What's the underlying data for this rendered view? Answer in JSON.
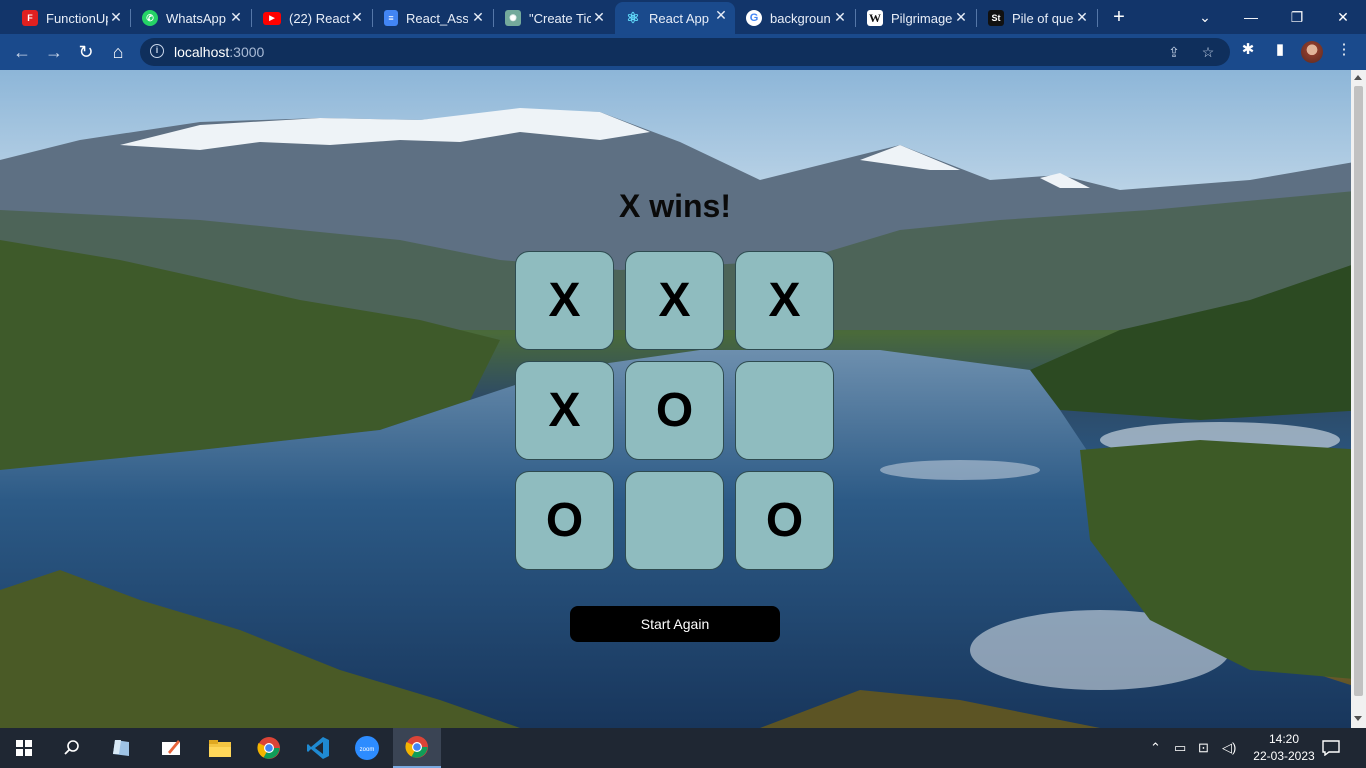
{
  "browser": {
    "tabs": [
      {
        "label": "FunctionUp",
        "icon": "functionup-icon",
        "color": "#e02020",
        "glyph": "F"
      },
      {
        "label": "WhatsApp",
        "icon": "whatsapp-icon",
        "color": "#25d366",
        "glyph": "✆"
      },
      {
        "label": "(22) React",
        "icon": "youtube-icon",
        "color": "#ff0000",
        "glyph": "▶"
      },
      {
        "label": "React_Assi",
        "icon": "google-docs-icon",
        "color": "#4285f4",
        "glyph": "≡"
      },
      {
        "label": "\"Create Tic",
        "icon": "chatgpt-icon",
        "color": "#74aa9c",
        "glyph": "✺"
      },
      {
        "label": "React App",
        "icon": "react-icon",
        "color": "#1a4a8c",
        "glyph": "⚛"
      },
      {
        "label": "backgroun",
        "icon": "google-icon",
        "color": "#ffffff",
        "glyph": "G"
      },
      {
        "label": "Pilgrimage",
        "icon": "wikipedia-icon",
        "color": "#ffffff",
        "glyph": "W"
      },
      {
        "label": "Pile of que",
        "icon": "stackoverflow-icon",
        "color": "#111111",
        "glyph": "St"
      }
    ],
    "active_tab": 5,
    "url_host": "localhost",
    "url_port": ":3000"
  },
  "game": {
    "status": "X wins!",
    "board": [
      "X",
      "X",
      "X",
      "X",
      "O",
      "",
      "O",
      "",
      "O"
    ],
    "restart_label": "Start Again"
  },
  "taskbar": {
    "time": "14:20",
    "date": "22-03-2023"
  },
  "colors": {
    "cell_bg": "#8fbcbf",
    "button_bg": "#000000",
    "chrome_dark": "#12356a",
    "chrome_toolbar": "#1a4a8c"
  }
}
